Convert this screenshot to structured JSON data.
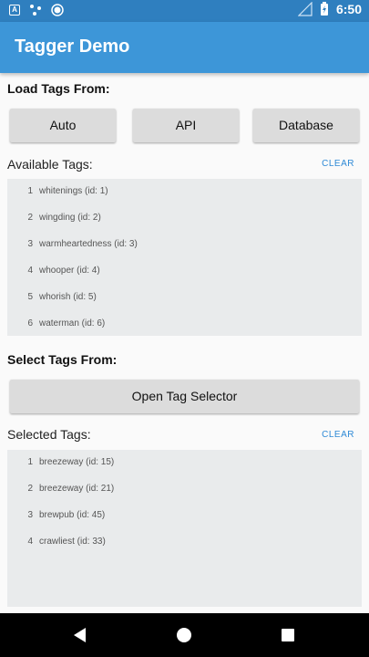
{
  "status_bar": {
    "time": "6:50",
    "icons": [
      "notification-a-icon",
      "dots-icon",
      "record-icon",
      "signal-icon",
      "battery-icon"
    ]
  },
  "app_bar": {
    "title": "Tagger Demo"
  },
  "load_section": {
    "title": "Load Tags From:",
    "buttons": [
      "Auto",
      "API",
      "Database"
    ]
  },
  "available": {
    "label": "Available Tags:",
    "clear_label": "CLEAR",
    "items": [
      {
        "num": "1",
        "text": "whitenings (id: 1)"
      },
      {
        "num": "2",
        "text": "wingding (id: 2)"
      },
      {
        "num": "3",
        "text": "warmheartedness (id: 3)"
      },
      {
        "num": "4",
        "text": "whooper (id: 4)"
      },
      {
        "num": "5",
        "text": "whorish (id: 5)"
      },
      {
        "num": "6",
        "text": "waterman (id: 6)"
      }
    ]
  },
  "select_section": {
    "title": "Select Tags From:",
    "button": "Open Tag Selector"
  },
  "selected": {
    "label": "Selected Tags:",
    "clear_label": "CLEAR",
    "items": [
      {
        "num": "1",
        "text": "breezeway (id: 15)"
      },
      {
        "num": "2",
        "text": "breezeway (id: 21)"
      },
      {
        "num": "3",
        "text": "brewpub (id: 45)"
      },
      {
        "num": "4",
        "text": "crawliest (id: 33)"
      }
    ]
  },
  "nav_bar": {
    "icons": [
      "back-icon",
      "home-icon",
      "recents-icon"
    ]
  }
}
